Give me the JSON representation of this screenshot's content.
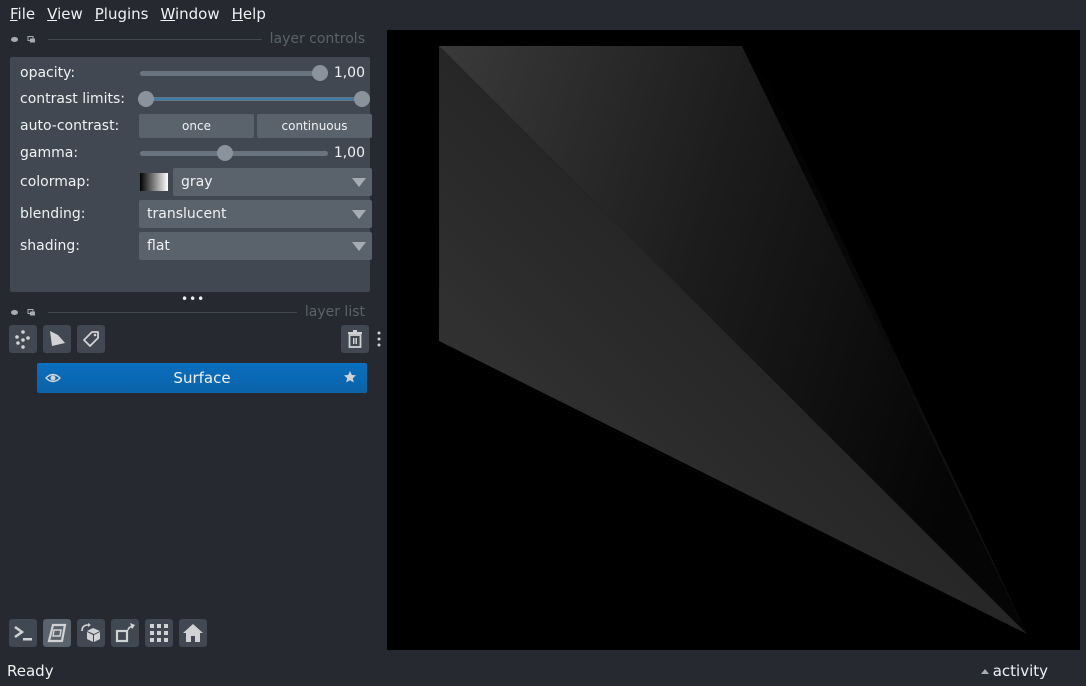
{
  "menubar": {
    "items": [
      {
        "label": "File",
        "mnemonic": "F",
        "rest": "ile"
      },
      {
        "label": "View",
        "mnemonic": "V",
        "rest": "iew"
      },
      {
        "label": "Plugins",
        "mnemonic": "P",
        "rest": "lugins"
      },
      {
        "label": "Window",
        "mnemonic": "W",
        "rest": "indow"
      },
      {
        "label": "Help",
        "mnemonic": "H",
        "rest": "elp"
      }
    ]
  },
  "layer_controls": {
    "title": "layer controls",
    "opacity": {
      "label": "opacity:",
      "value": "1,00",
      "fraction": 1.0
    },
    "contrast_limits": {
      "label": "contrast limits:",
      "low_fraction": 0.0,
      "high_fraction": 1.0
    },
    "auto_contrast": {
      "label": "auto-contrast:",
      "once_label": "once",
      "continuous_label": "continuous"
    },
    "gamma": {
      "label": "gamma:",
      "value": "1,00",
      "fraction": 0.45
    },
    "colormap": {
      "label": "colormap:",
      "value": "gray"
    },
    "blending": {
      "label": "blending:",
      "value": "translucent"
    },
    "shading": {
      "label": "shading:",
      "value": "flat"
    }
  },
  "layer_list": {
    "title": "layer list",
    "buttons": {
      "new_points": "new-points-icon",
      "new_shapes": "new-shapes-icon",
      "new_labels": "new-labels-icon",
      "delete": "trash-icon"
    },
    "layers": [
      {
        "name": "Surface",
        "visible": true,
        "selected": true
      }
    ]
  },
  "viewer_buttons": [
    {
      "name": "console",
      "icon": "console-icon",
      "active": false
    },
    {
      "name": "toggle-ndisplay",
      "icon": "3d-cube-icon",
      "active": true
    },
    {
      "name": "roll-dims",
      "icon": "roll-icon",
      "active": false
    },
    {
      "name": "transpose-dims",
      "icon": "transpose-icon",
      "active": false
    },
    {
      "name": "grid-view",
      "icon": "grid-icon",
      "active": false
    },
    {
      "name": "reset-view",
      "icon": "home-icon",
      "active": false
    }
  ],
  "status": {
    "text": "Ready",
    "activity_label": "activity"
  },
  "colors": {
    "background": "#262930",
    "panel": "#414851",
    "control": "#5a626c",
    "selection": "#0a6fbf",
    "canvas": "#000000"
  }
}
